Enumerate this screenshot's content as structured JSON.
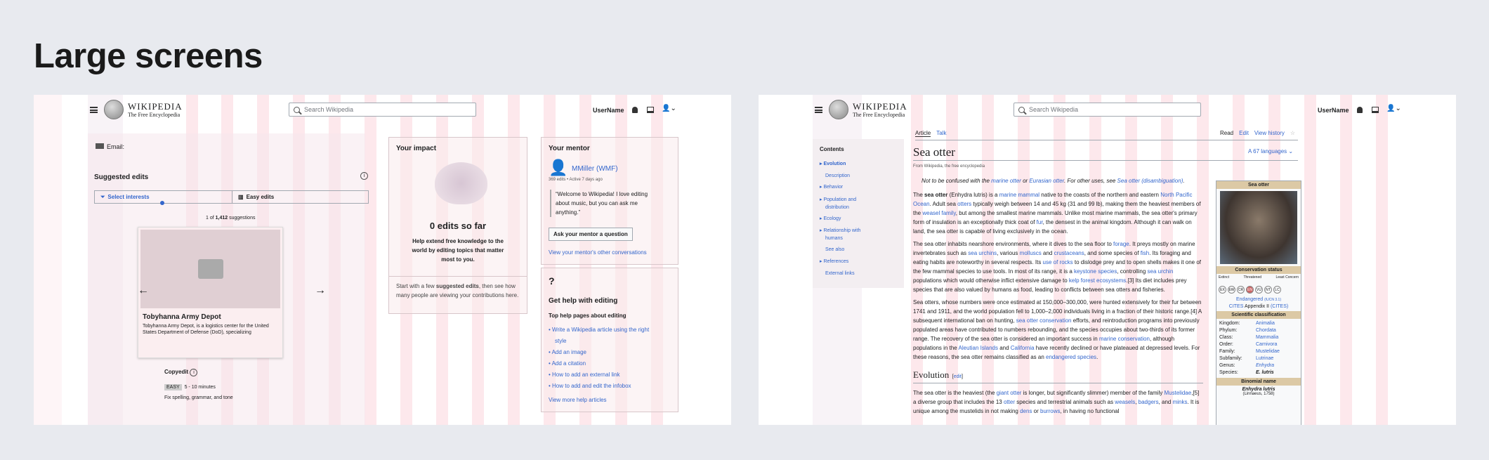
{
  "heading": "Large screens",
  "header": {
    "wordmark": "Wikipedia",
    "tagline": "The Free Encyclopedia",
    "search_placeholder": "Search Wikipedia",
    "username": "UserName"
  },
  "left": {
    "email_label": "Email:",
    "suggested": {
      "title": "Suggested edits",
      "tab_interests": "Select interests",
      "tab_easy": "Easy edits",
      "count_prefix": "1 of ",
      "count": "1,412",
      "count_suffix": " suggestions",
      "card_title": "Tobyhanna Army Depot",
      "card_desc": "Tobyhanna Army Depot, is a logistics center for the United States Department of Defense (DoD), specializing",
      "task_title": "Copyedit",
      "difficulty": "EASY",
      "time": "5 - 10 minutes",
      "task_desc": "Fix spelling, grammar, and tone"
    },
    "impact": {
      "title": "Your impact",
      "headline": "0 edits so far",
      "subtitle": "Help extend free knowledge to the world by editing topics that matter most to you.",
      "footer_pre": "Start with a few ",
      "footer_bold": "suggested edits",
      "footer_post": ", then see how many people are viewing your contributions here."
    },
    "mentor": {
      "title": "Your mentor",
      "name": "MMiller (WMF)",
      "meta": "369 edits • Active 7 days ago",
      "quote": "“Welcome to Wikipedia! I love editing about music, but you can ask me anything.”",
      "ask_button": "Ask your mentor a question",
      "view_link": "View your mentor's other conversations"
    },
    "help": {
      "icon_text": "?",
      "title": "Get help with editing",
      "subtitle": "Top help pages about editing",
      "links": [
        "Write a Wikipedia article using the right",
        "style",
        "Add an image",
        "Add a citation",
        "How to add an external link",
        "How to add and edit the infobox"
      ],
      "more": "View more help articles"
    }
  },
  "right": {
    "tabs": {
      "article": "Article",
      "talk": "Talk",
      "read": "Read",
      "edit": "Edit",
      "history": "View history"
    },
    "toc": {
      "title": "Contents",
      "items": [
        "Evolution",
        "Description",
        "Behavior",
        "Population and",
        "distribution",
        "Ecology",
        "Relationship with",
        "humans",
        "See also",
        "References",
        "External links"
      ]
    },
    "title": "Sea otter",
    "languages": "67 languages",
    "from": "From Wikipedia, the free encyclopedia",
    "hatnote_a": "Not to be confused with the ",
    "hatnote_b": "marine otter",
    "hatnote_c": " or ",
    "hatnote_d": "Eurasian otter",
    "hatnote_e": ". For other uses, see ",
    "hatnote_f": "Sea otter (disambiguation)",
    "hatnote_g": ".",
    "paras": [
      [
        "The ",
        "sea otter",
        " (Enhydra lutris) is a ",
        "marine mammal",
        " native to the coasts of the northern and eastern ",
        "North Pacific Ocean",
        ". Adult sea ",
        "otters",
        " typically weigh between 14 and 45 kg (31 and 99 lb), making them the heaviest members of the ",
        "weasel family",
        ", but among the smallest marine mammals. Unlike most marine mammals, the sea otter's primary form of insulation is an exceptionally thick coat of ",
        "fur",
        ", the densest in the animal kingdom. Although it can walk on land, the sea otter is capable of living exclusively in the ocean."
      ],
      [
        "The sea otter inhabits nearshore environments, where it dives to the sea floor to ",
        "forage",
        ". It preys mostly on marine invertebrates such as ",
        "sea urchins",
        ", various ",
        "molluscs",
        " and ",
        "crustaceans",
        ", and some species of ",
        "fish",
        ". Its foraging and eating habits are noteworthy in several respects. Its ",
        "use of rocks",
        " to dislodge prey and to open shells makes it one of the few mammal species to use tools. In most of its range, it is a ",
        "keystone species",
        ", controlling ",
        "sea urchin",
        " populations which would otherwise inflict extensive damage to ",
        "kelp forest ecosystems",
        ".[3] Its diet includes prey species that are also valued by humans as food, leading to conflicts between sea otters and fisheries."
      ],
      [
        "Sea otters, whose numbers were once estimated at 150,000–300,000, were hunted extensively for their fur between 1741 and 1911, and the world population fell to 1,000–2,000 individuals living in a fraction of their historic range.[4] A subsequent international ban on hunting, ",
        "sea otter conservation",
        " efforts, and reintroduction programs into previously populated areas have contributed to numbers rebounding, and the species occupies about two-thirds of its former range. The recovery of the sea otter is considered an important success in ",
        "marine conservation",
        ", although populations in the ",
        "Aleutian Islands",
        " and ",
        "California",
        " have recently declined or have plateaued at depressed levels. For these reasons, the sea otter remains classified as an ",
        "endangered species",
        "."
      ]
    ],
    "section": "Evolution",
    "section_edit": "edit",
    "evolution": [
      "The sea otter is the heaviest (the ",
      "giant otter",
      " is longer, but significantly slimmer) member of the family ",
      "Mustelidae",
      ",[5] a diverse group that includes the 13 ",
      "otter",
      " species and terrestrial animals such as ",
      "weasels",
      ", ",
      "badgers",
      ", and ",
      "minks",
      ". It is unique among the mustelids in not making ",
      "dens",
      " or ",
      "burrows",
      ", in having no functional"
    ],
    "infobox": {
      "title": "Sea otter",
      "status_head": "Conservation status",
      "status_labels": [
        "Extinct",
        "Threatened",
        "Least Concern"
      ],
      "codes": [
        "EX",
        "EW",
        "CR",
        "EN",
        "VU",
        "NT",
        "LC"
      ],
      "status": "Endangered",
      "status_ref": "(IUCN 3.1)",
      "cites_a": "CITES",
      "cites_b": " Appendix II ",
      "cites_c": "(CITES)",
      "class_head": "Scientific classification",
      "taxo": [
        [
          "Kingdom:",
          "Animalia"
        ],
        [
          "Phylum:",
          "Chordata"
        ],
        [
          "Class:",
          "Mammalia"
        ],
        [
          "Order:",
          "Carnivora"
        ],
        [
          "Family:",
          "Mustelidae"
        ],
        [
          "Subfamily:",
          "Lutrinae"
        ],
        [
          "Genus:",
          "Enhydra"
        ],
        [
          "Species:",
          "E. lutris"
        ]
      ],
      "binomial_head": "Binomial name",
      "binomial": "Enhydra lutris",
      "authority": "(Linnaeus, 1758)"
    }
  }
}
